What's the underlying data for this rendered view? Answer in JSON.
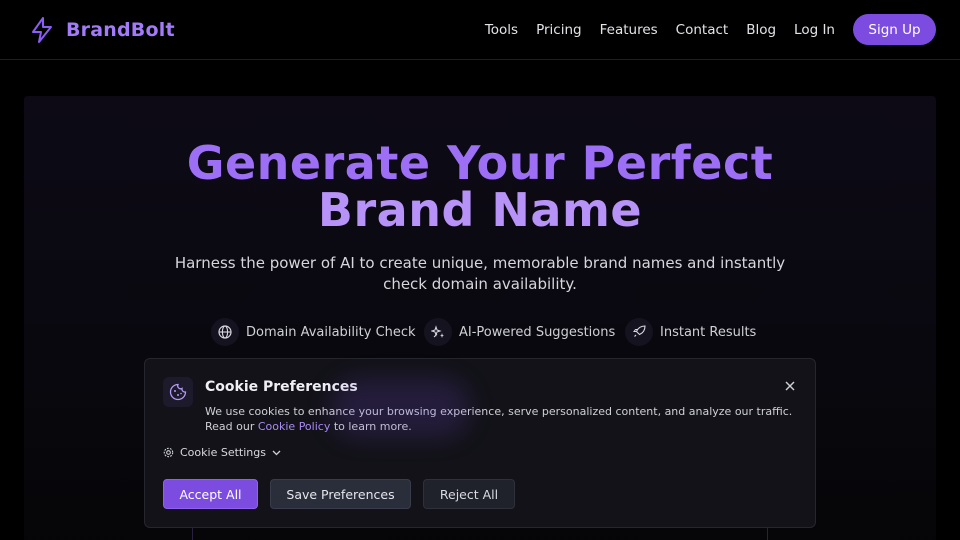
{
  "brand": {
    "name": "BrandBolt",
    "icon": "lightning-bolt-icon"
  },
  "nav": {
    "links": [
      "Tools",
      "Pricing",
      "Features",
      "Contact",
      "Blog",
      "Log In"
    ],
    "signup_label": "Sign Up"
  },
  "hero": {
    "title_line1": "Generate Your Perfect",
    "title_line2": "Brand Name",
    "subtitle": "Harness the power of AI to create unique, memorable brand names and instantly check domain availability.",
    "features": [
      {
        "icon": "globe-icon",
        "label": "Domain Availability Check"
      },
      {
        "icon": "sparkles-icon",
        "label": "AI-Powered Suggestions"
      },
      {
        "icon": "rocket-icon",
        "label": "Instant Results"
      }
    ]
  },
  "cookie": {
    "icon": "cookie-icon",
    "title": "Cookie Preferences",
    "text_before": "We use cookies to enhance your browsing experience, serve personalized content, and analyze our traffic. Read our ",
    "link": "Cookie Policy",
    "text_after": " to learn more.",
    "settings_label": "Cookie Settings",
    "accept_label": "Accept All",
    "save_label": "Save Preferences",
    "reject_label": "Reject All"
  },
  "colors": {
    "accent": "#7c4ce0",
    "brand_text": "#a37af8",
    "background": "#000000"
  }
}
